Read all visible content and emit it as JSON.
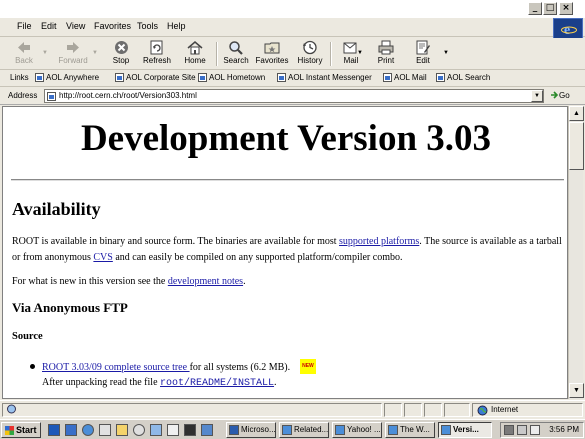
{
  "window": {
    "min_label": "_",
    "max_label": "□",
    "close_label": "×"
  },
  "menu": [
    "File",
    "Edit",
    "View",
    "Favorites",
    "Tools",
    "Help"
  ],
  "toolbar": {
    "back": "Back",
    "forward": "Forward",
    "stop": "Stop",
    "refresh": "Refresh",
    "home": "Home",
    "search": "Search",
    "favorites": "Favorites",
    "history": "History",
    "mail": "Mail",
    "print": "Print",
    "edit": "Edit"
  },
  "links": {
    "label": "Links",
    "items": [
      "AOL Anywhere",
      "AOL Corporate Site",
      "AOL Hometown",
      "AOL Instant Messenger",
      "AOL Mail",
      "AOL Search"
    ]
  },
  "address": {
    "label": "Address",
    "url": "http://root.cern.ch/root/Version303.html",
    "go": "Go"
  },
  "page": {
    "title": "Development Version 3.03",
    "availability_heading": "Availability",
    "avail_text_1": "ROOT is available in binary and source form. The binaries are available for most ",
    "avail_link_1": "supported platforms",
    "avail_text_2": ". The source is available as a tarball or from anonymous ",
    "avail_link_2": "CVS",
    "avail_text_3": " and can easily be compiled on any supported platform/compiler combo.",
    "new_text": "For what is new in this version see the ",
    "new_link": "development notes",
    "new_end": ".",
    "ftp_heading": "Via Anonymous FTP",
    "source_heading": "Source",
    "src_link": "ROOT 3.03/09 complete source tree ",
    "src_text": "for all systems (6.2 MB).",
    "new_badge": "NEW",
    "unpack_text": "After unpacking read the file ",
    "unpack_file": "root/README/INSTALL",
    "unpack_end": "."
  },
  "status": {
    "zone": "Internet"
  },
  "taskbar": {
    "start": "Start",
    "tasks": [
      "Microso...",
      "Related...",
      "Yahoo! ...",
      "The W...",
      "Versi..."
    ],
    "clock": "3:56 PM"
  }
}
